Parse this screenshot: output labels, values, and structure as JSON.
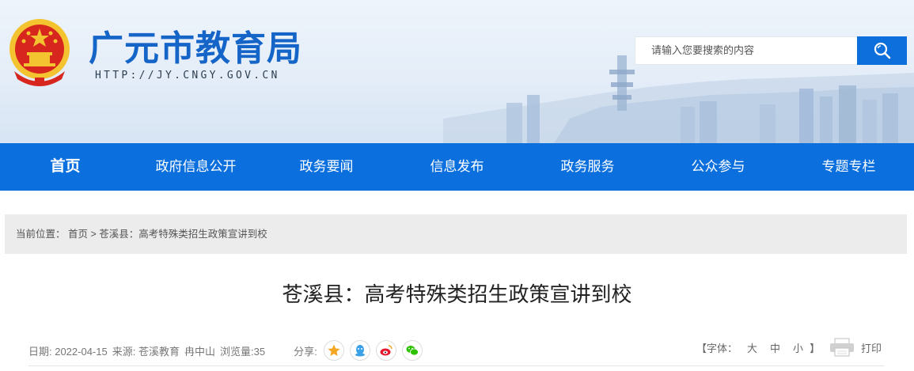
{
  "header": {
    "title": "广元市教育局",
    "url": "HTTP://JY.CNGY.GOV.CN",
    "search_placeholder": "请输入您要搜索的内容"
  },
  "nav": {
    "items": [
      {
        "label": "首页"
      },
      {
        "label": "政府信息公开"
      },
      {
        "label": "政务要闻"
      },
      {
        "label": "信息发布"
      },
      {
        "label": "政务服务"
      },
      {
        "label": "公众参与"
      },
      {
        "label": "专题专栏"
      }
    ],
    "active_index": 0
  },
  "breadcrumb": {
    "prefix": "当前位置：",
    "home": "首页",
    "separator": ">",
    "current": "苍溪县：高考特殊类招生政策宣讲到校"
  },
  "article": {
    "title": "苍溪县：高考特殊类招生政策宣讲到校",
    "date": "日期: 2022-04-15",
    "source": "来源: 苍溪教育",
    "author": "冉中山",
    "views": "浏览量:35",
    "share_label": "分享:",
    "fontsize_label": "【字体：",
    "font_large": "大",
    "font_medium": "中",
    "font_small": "小",
    "fontsize_close": "】",
    "print_label": "打印"
  },
  "colors": {
    "brand_blue": "#0b70de",
    "title_blue": "#1565c8",
    "breadcrumb_bg": "#ececec"
  },
  "icons": [
    "national-emblem-icon",
    "search-icon",
    "qzone-icon",
    "qq-icon",
    "weibo-icon",
    "wechat-icon",
    "printer-icon"
  ]
}
